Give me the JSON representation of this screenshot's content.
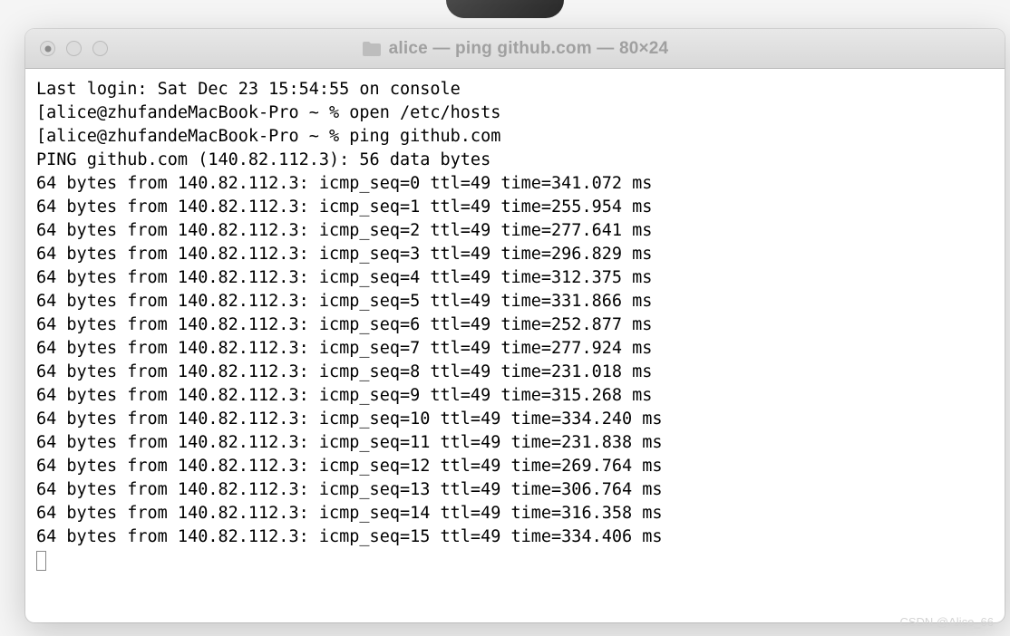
{
  "window": {
    "title": "alice — ping github.com — 80×24"
  },
  "session": {
    "last_login": "Last login: Sat Dec 23 15:54:55 on console",
    "prompt": "alice@zhufandeMacBook-Pro ~ %",
    "commands": {
      "cmd1": "open /etc/hosts",
      "cmd2": "ping github.com"
    }
  },
  "ping": {
    "header": "PING github.com (140.82.112.3): 56 data bytes",
    "from_ip": "140.82.112.3",
    "bytes": 64,
    "ttl": 49,
    "replies": [
      {
        "seq": 0,
        "time": "341.072"
      },
      {
        "seq": 1,
        "time": "255.954"
      },
      {
        "seq": 2,
        "time": "277.641"
      },
      {
        "seq": 3,
        "time": "296.829"
      },
      {
        "seq": 4,
        "time": "312.375"
      },
      {
        "seq": 5,
        "time": "331.866"
      },
      {
        "seq": 6,
        "time": "252.877"
      },
      {
        "seq": 7,
        "time": "277.924"
      },
      {
        "seq": 8,
        "time": "231.018"
      },
      {
        "seq": 9,
        "time": "315.268"
      },
      {
        "seq": 10,
        "time": "334.240"
      },
      {
        "seq": 11,
        "time": "231.838"
      },
      {
        "seq": 12,
        "time": "269.764"
      },
      {
        "seq": 13,
        "time": "306.764"
      },
      {
        "seq": 14,
        "time": "316.358"
      },
      {
        "seq": 15,
        "time": "334.406"
      }
    ]
  },
  "watermark": "CSDN @Alice_66"
}
